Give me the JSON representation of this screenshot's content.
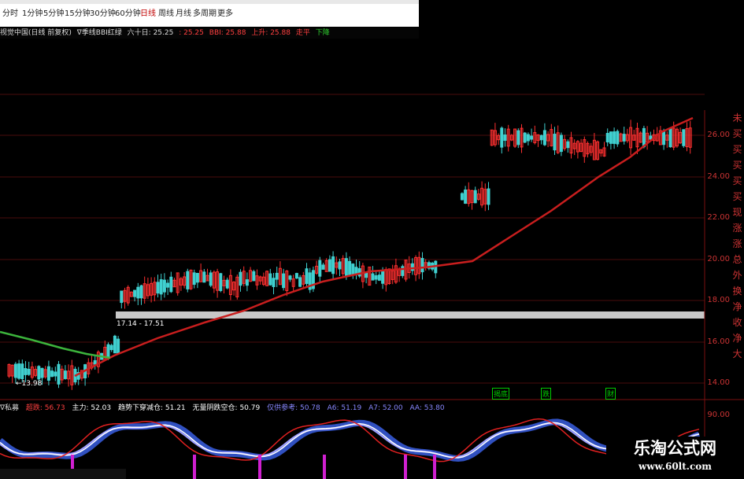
{
  "toolbar": {
    "periods": [
      "分时",
      "1分钟",
      "5分钟",
      "15分钟",
      "30分钟",
      "60分钟",
      "日线",
      "周线",
      "月线",
      "多周期",
      "更多"
    ],
    "active": "日线"
  },
  "info": {
    "stock": "视觉中国(日线 前复权)",
    "indicator": "∇季线BBI红绿",
    "sixty_label": "六十日: 25.25",
    "v1": ": 25.25",
    "bbi": "BBI: 25.88",
    "rise": "上升: 25.88",
    "status_rise": "走平",
    "status_fall": "下降"
  },
  "price_axis": {
    "labels": [
      "26.00",
      "24.00",
      "22.00",
      "20.00",
      "18.00",
      "16.00",
      "14.00"
    ]
  },
  "right_strip": [
    "未",
    "买",
    "买",
    "买",
    "买",
    "买",
    "现",
    "涨",
    "涨",
    "总",
    "外",
    "换",
    "净",
    "收",
    "净",
    "大"
  ],
  "annotations": {
    "range": "17.14 - 17.51",
    "low": "←13.98",
    "tag1": "揭底",
    "tag2": "跌",
    "tag3": "财"
  },
  "indicator_bar": {
    "name": "∇私募",
    "items": [
      {
        "label": "超跌: 56.73",
        "color": "#ff4040"
      },
      {
        "label": "主力: 52.03",
        "color": "#ffffff"
      },
      {
        "label": "趋势下穿减仓: 51.21",
        "color": "#ffffff"
      },
      {
        "label": "无量阴跌空仓: 50.79",
        "color": "#ffffff"
      },
      {
        "label": "仅供参考: 50.78",
        "color": "#8888ff"
      },
      {
        "label": "A6: 51.19",
        "color": "#8888ff"
      },
      {
        "label": "A7: 52.00",
        "color": "#8888ff"
      },
      {
        "label": "AA: 53.80",
        "color": "#8888ff"
      }
    ]
  },
  "indicator_axis": [
    "90.00"
  ],
  "watermark": {
    "title": "乐淘公式网",
    "url": "www.60lt.com"
  },
  "colors": {
    "up": "#ff3030",
    "down": "#40d0d0",
    "ma": "#c81e1e",
    "ma_green": "#3cb43c",
    "accent": "#c00000"
  }
}
